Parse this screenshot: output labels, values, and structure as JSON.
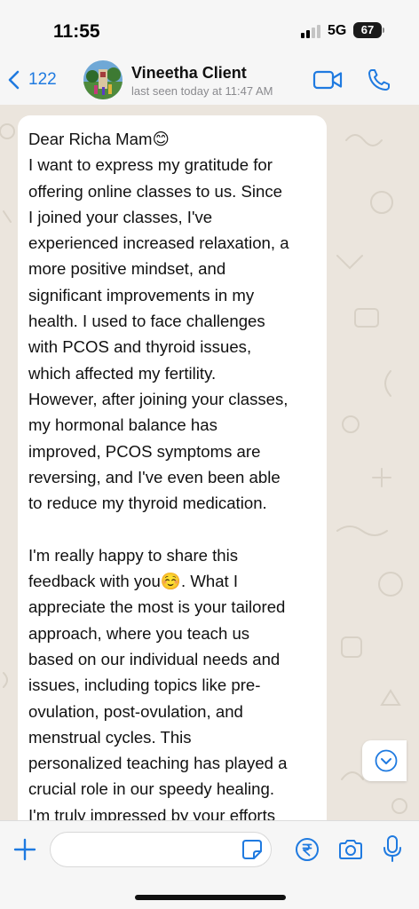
{
  "status_bar": {
    "time": "11:55",
    "network": "5G",
    "battery": "67"
  },
  "header": {
    "back_count": "122",
    "contact_name": "Vineetha Client",
    "last_seen": "last seen today at 11:47 AM"
  },
  "message": {
    "paragraphs": [
      "Dear Richa Mam😊\nI want to express my gratitude for\noffering online classes to us. Since\nI joined your classes, I've\nexperienced increased relaxation, a\nmore positive mindset, and\nsignificant improvements in my\nhealth. I used to face challenges\nwith PCOS and thyroid issues,\nwhich affected my fertility.\nHowever, after joining your classes,\nmy hormonal balance has\nimproved, PCOS symptoms are\nreversing, and I've even been able\nto reduce my thyroid medication.",
      "I'm really happy to share this\nfeedback with you☺️. What I\nappreciate the most is your tailored\napproach, where you teach us\nbased on our individual needs and\nissues, including topics like pre-\novulation, post-ovulation, and\nmenstrual cycles. This\npersonalized teaching has played a\ncrucial role in our speedy healing.\nI'm truly impressed by your efforts"
    ]
  },
  "composer": {
    "placeholder": ""
  },
  "icons": {
    "back": "chevron-left-icon",
    "video": "video-camera-icon",
    "call": "phone-icon",
    "scroll": "chevron-down-circle-icon",
    "plus": "plus-icon",
    "sticker": "sticker-icon",
    "payment": "rupee-icon",
    "camera": "camera-icon",
    "mic": "microphone-icon"
  },
  "colors": {
    "accent": "#1f7ae0",
    "chat_background": "#ebe5dd",
    "bubble": "#ffffff"
  }
}
